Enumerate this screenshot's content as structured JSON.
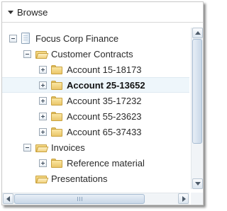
{
  "header": {
    "title": "Browse"
  },
  "tree": {
    "root": {
      "label": "Focus Corp Finance"
    },
    "customer_contracts": {
      "label": "Customer Contracts"
    },
    "accounts": [
      {
        "label": "Account 15-18173"
      },
      {
        "label": "Account 25-13652",
        "selected": true
      },
      {
        "label": "Account 35-17232"
      },
      {
        "label": "Account 55-23623"
      },
      {
        "label": "Account 65-37433"
      }
    ],
    "invoices": {
      "label": "Invoices"
    },
    "reference_material": {
      "label": "Reference material"
    },
    "presentations": {
      "label": "Presentations"
    }
  },
  "icons": [
    "caret-down-icon",
    "collapse-icon",
    "expand-icon",
    "document-icon",
    "folder-icon",
    "folder-open-icon",
    "scroll-up-icon",
    "scroll-down-icon",
    "scroll-left-icon",
    "scroll-right-icon"
  ],
  "colors": {
    "selection_bg": "#eef6fb",
    "folder": "#eac66a",
    "scroll_thumb": "#c9d8e8"
  }
}
